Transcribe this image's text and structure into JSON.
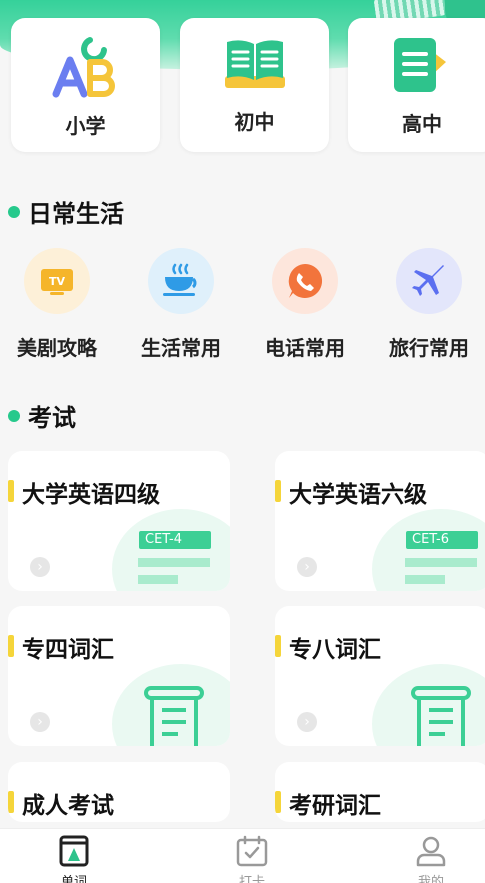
{
  "levels": [
    {
      "label": "小学",
      "icon": "abc-letters-icon"
    },
    {
      "label": "初中",
      "icon": "open-book-icon"
    },
    {
      "label": "高中",
      "icon": "notebook-icon"
    }
  ],
  "daily": {
    "title": "日常生活",
    "items": [
      {
        "label": "美剧攻略",
        "icon": "tv-icon",
        "bg": "#fdf0d8"
      },
      {
        "label": "生活常用",
        "icon": "coffee-cup-icon",
        "bg": "#dff0fb"
      },
      {
        "label": "电话常用",
        "icon": "phone-icon",
        "bg": "#fde6dc"
      },
      {
        "label": "旅行常用",
        "icon": "airplane-icon",
        "bg": "#e3e6fb"
      }
    ]
  },
  "exam": {
    "title": "考试",
    "cards": [
      {
        "title": "大学英语四级",
        "badge": "CET-4"
      },
      {
        "title": "大学英语六级",
        "badge": "CET-6"
      },
      {
        "title": "专四词汇"
      },
      {
        "title": "专八词汇"
      },
      {
        "title": "成人考试"
      },
      {
        "title": "考研词汇"
      }
    ]
  },
  "nav": {
    "items": [
      {
        "label": "单词",
        "icon": "word-book-icon",
        "active": true
      },
      {
        "label": "打卡",
        "icon": "calendar-check-icon",
        "active": false
      },
      {
        "label": "我的",
        "icon": "user-icon",
        "active": false
      }
    ]
  },
  "colors": {
    "accent": "#26c98c",
    "marker": "#f5d53a"
  }
}
